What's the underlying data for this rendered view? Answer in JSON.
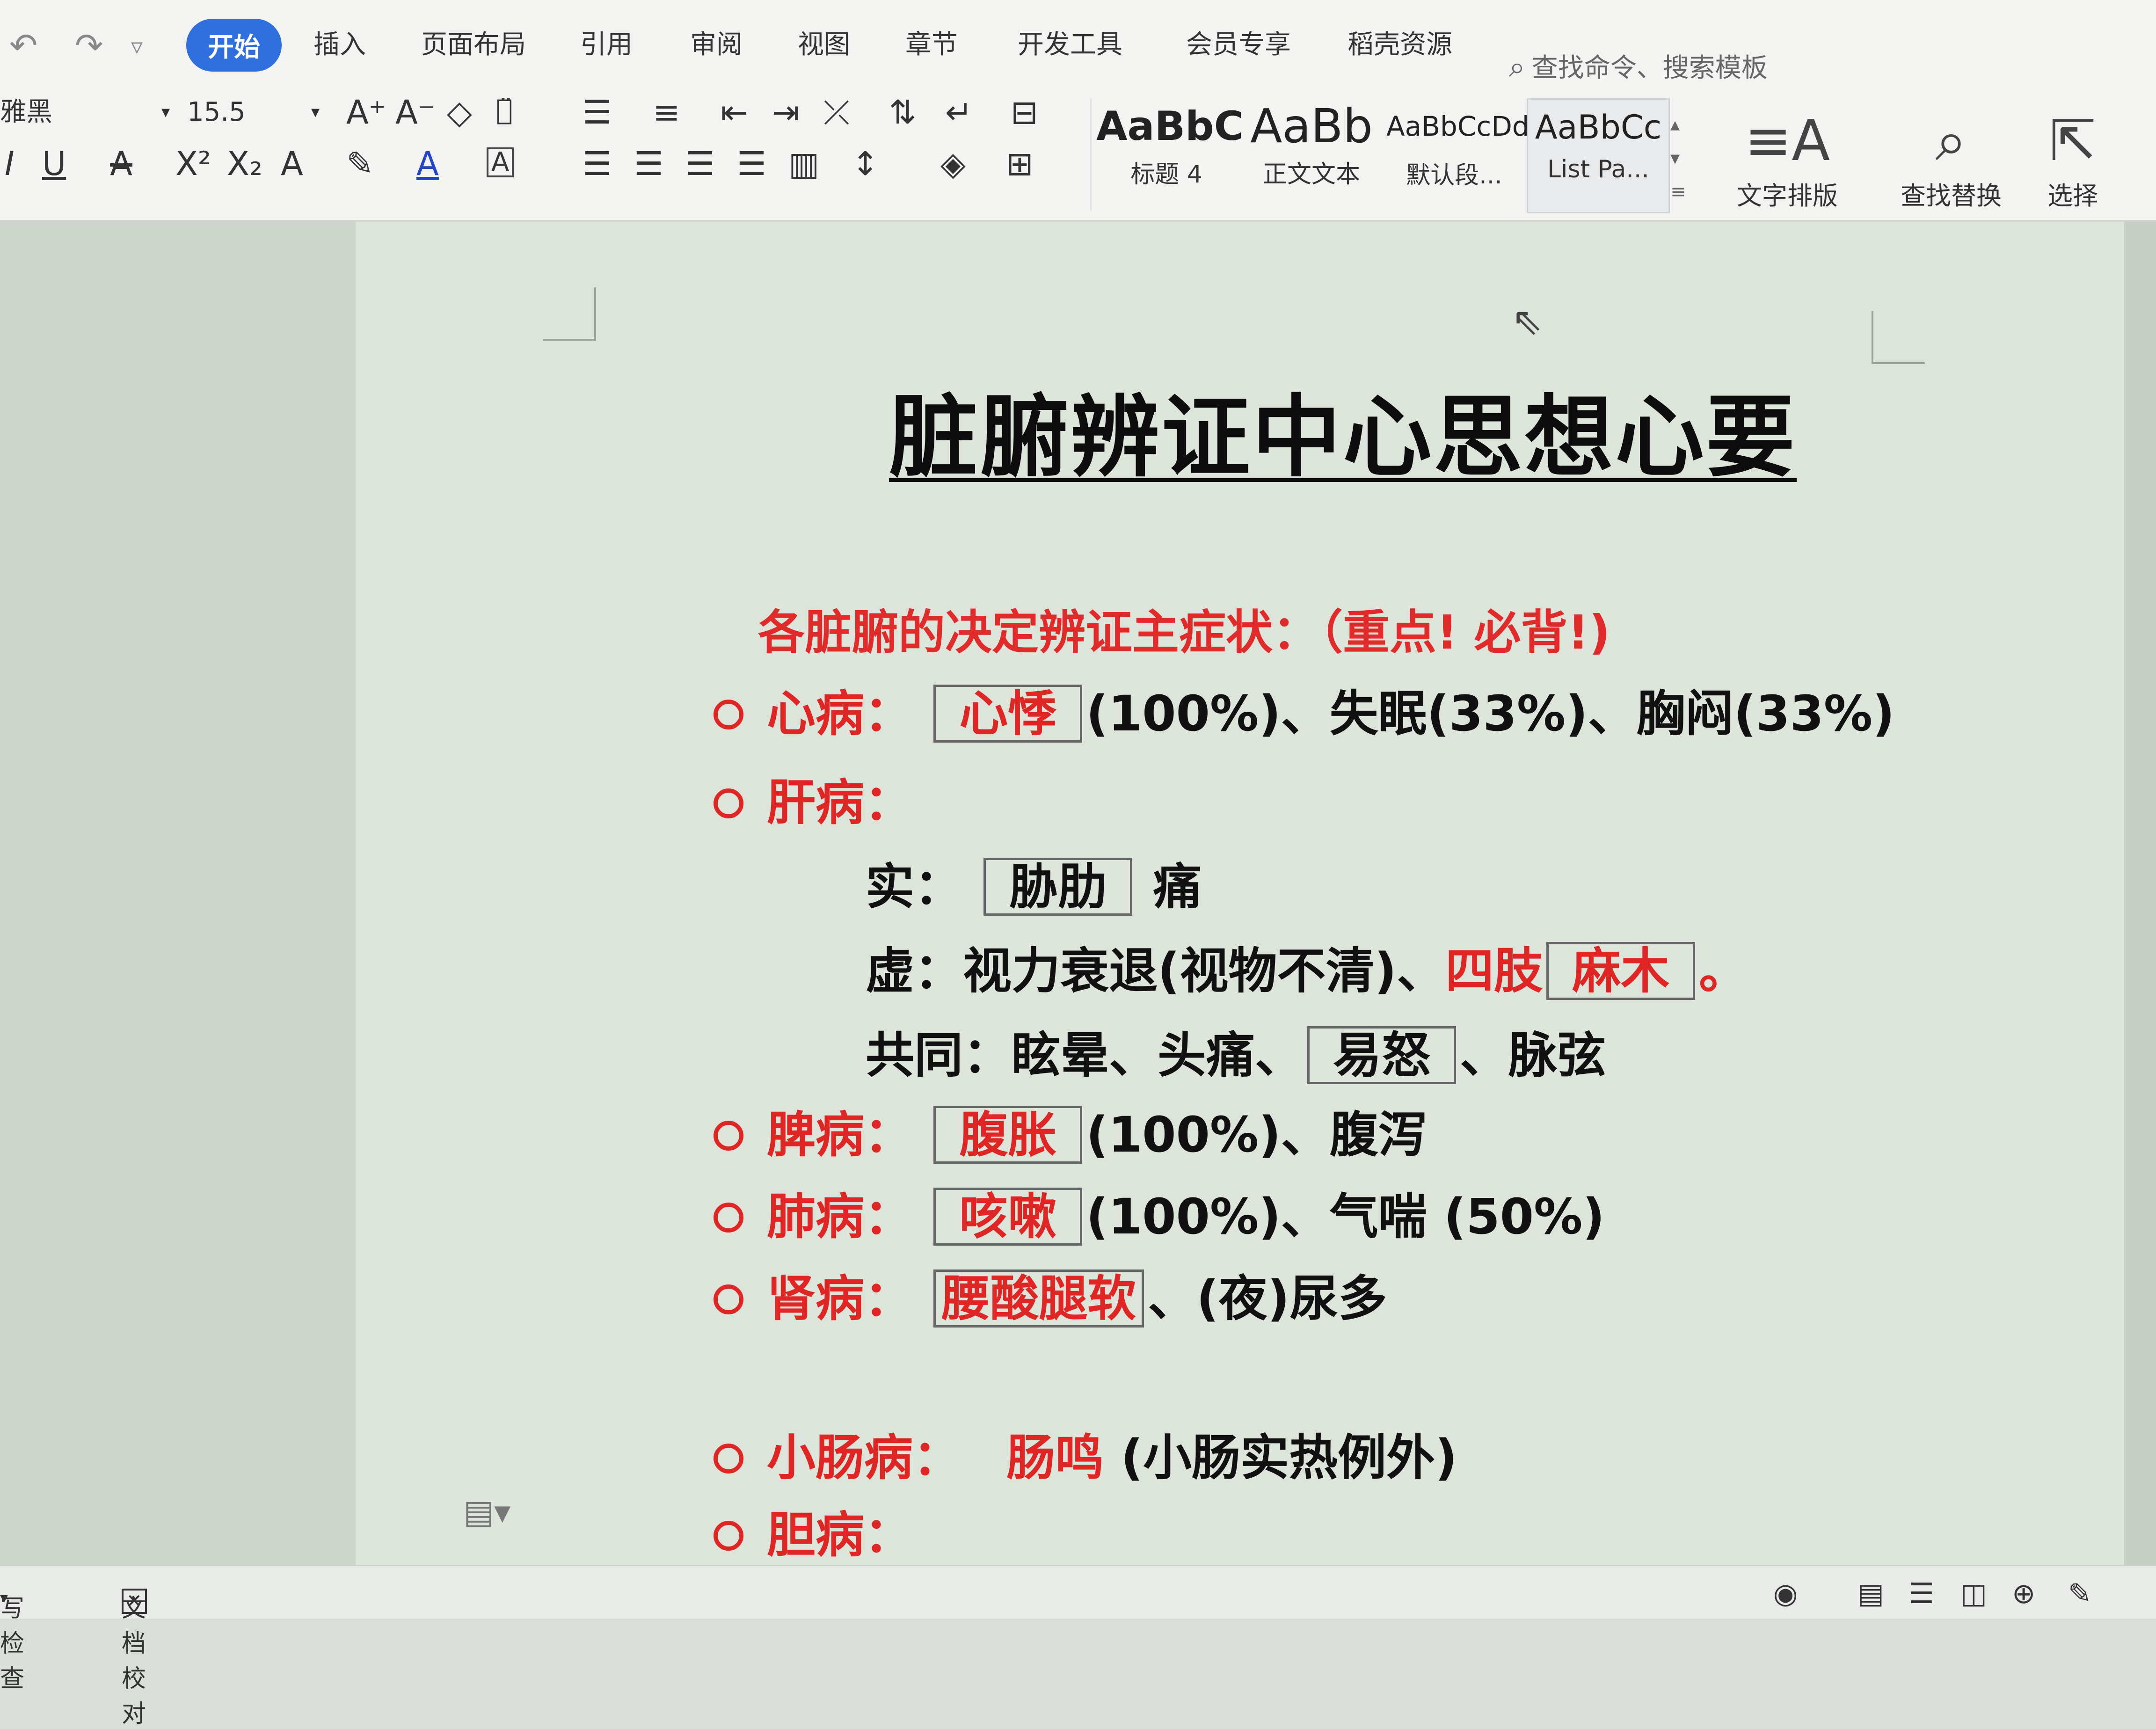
{
  "ribbon": {
    "tabs": [
      "开始",
      "插入",
      "页面布局",
      "引用",
      "审阅",
      "视图",
      "章节",
      "开发工具",
      "会员专享",
      "稻壳资源"
    ],
    "search_placeholder": "查找命令、搜索模板",
    "font_name": "雅黑",
    "font_size": "15.5",
    "styles": [
      {
        "sample": "AaBbC",
        "name": "标题 4"
      },
      {
        "sample": "AaBb",
        "name": "正文文本"
      },
      {
        "sample": "AaBbCcDd",
        "name": "默认段..."
      },
      {
        "sample": "AaBbCc",
        "name": "List Pa..."
      }
    ],
    "text_layout_label": "文字排版",
    "find_replace_label": "查找替换",
    "select_label": "选择"
  },
  "document": {
    "title": "脏腑辨证中心思想心要",
    "heading": "各脏腑的决定辨证主症状：（重点! 必背!)",
    "heart": {
      "label": "心病：",
      "key": "心悸",
      "rest": "(100%)、失眠(33%)、胸闷(33%)"
    },
    "liver": {
      "label": "肝病：",
      "shi_label": "实：",
      "shi_key": "胁肋",
      "shi_rest": "痛",
      "xu_label": "虚：视力衰退(视物不清)、",
      "xu_red": "四肢",
      "xu_key": "麻木",
      "xu_end": "。",
      "common_label": "共同：眩晕、头痛、",
      "common_key": "易怒",
      "common_rest": "、脉弦"
    },
    "spleen": {
      "label": "脾病：",
      "key": "腹胀",
      "rest": "(100%)、腹泻"
    },
    "lung": {
      "label": "肺病：",
      "key": "咳嗽",
      "rest": "(100%)、气喘 (50%)"
    },
    "kidney": {
      "label": "肾病：",
      "key": "腰酸腿软",
      "rest": "、(夜)尿多"
    },
    "small_intestine": {
      "label": "小肠病：",
      "key": "肠鸣",
      "rest": "(小肠实热例外)"
    },
    "gallbladder": {
      "label": "胆病："
    }
  },
  "status": {
    "spellcheck": "写检查",
    "proofread": "文档校对"
  },
  "colors": {
    "accent": "#2f6fde",
    "emphasis": "#e02525"
  }
}
